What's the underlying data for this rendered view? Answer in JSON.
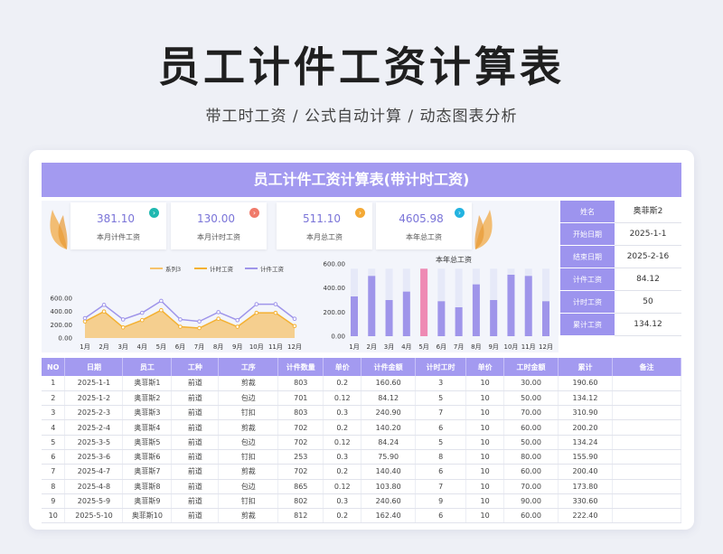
{
  "hero": {
    "title": "员工计件工资计算表",
    "subtitle": "带工时工资 /  公式自动计算  /  动态图表分析"
  },
  "banner": {
    "title": "员工计件工资计算表(带计时工资)"
  },
  "kpis": [
    {
      "value": "381.10",
      "label": "本月计件工资",
      "icon": "chevron-right-icon",
      "color": "#1fb8b0"
    },
    {
      "value": "130.00",
      "label": "本月计时工资",
      "icon": "chevron-right-icon",
      "color": "#f07a6a"
    },
    {
      "value": "511.10",
      "label": "本月总工资",
      "icon": "chevron-right-icon",
      "color": "#f4a935"
    },
    {
      "value": "4605.98",
      "label": "本年总工资",
      "icon": "chevron-right-icon",
      "color": "#23b3e0"
    }
  ],
  "side_info": [
    {
      "key": "姓名",
      "value": "奥菲斯2"
    },
    {
      "key": "开始日期",
      "value": "2025-1-1"
    },
    {
      "key": "结束日期",
      "value": "2025-2-16"
    },
    {
      "key": "计件工资",
      "value": "84.12"
    },
    {
      "key": "计时工资",
      "value": "50"
    },
    {
      "key": "累计工资",
      "value": "134.12"
    }
  ],
  "chart_data": [
    {
      "type": "line",
      "categories": [
        "1月",
        "2月",
        "3月",
        "4月",
        "5月",
        "6月",
        "7月",
        "8月",
        "9月",
        "10月",
        "11月",
        "12月"
      ],
      "series": [
        {
          "name": "系列3",
          "values": [
            250,
            400,
            160,
            270,
            420,
            170,
            150,
            290,
            170,
            380,
            380,
            180
          ],
          "color": "#f6c26b"
        },
        {
          "name": "计时工资",
          "values": [
            250,
            400,
            160,
            270,
            420,
            170,
            150,
            290,
            170,
            380,
            380,
            180
          ],
          "color": "#f4b132"
        },
        {
          "name": "计件工资",
          "values": [
            300,
            500,
            280,
            380,
            560,
            280,
            250,
            390,
            270,
            510,
            510,
            290
          ],
          "color": "#9f95ea"
        }
      ],
      "ylim": [
        0,
        600
      ],
      "yticks": [
        "600.00",
        "400.00",
        "200.00",
        "0.00"
      ],
      "legend": "top"
    },
    {
      "type": "bar",
      "title": "本年总工资",
      "categories": [
        "1月",
        "2月",
        "3月",
        "4月",
        "5月",
        "6月",
        "7月",
        "8月",
        "9月",
        "10月",
        "11月",
        "12月"
      ],
      "values": [
        330,
        500,
        300,
        370,
        560,
        290,
        240,
        430,
        300,
        510,
        500,
        290
      ],
      "background_max": 560,
      "highlight_index": 4,
      "bar_color": "#9f95ea",
      "highlight_color": "#ee8ab4",
      "background_color": "#e6e9f8",
      "ylim": [
        0,
        600
      ],
      "yticks": [
        "600.00",
        "400.00",
        "200.00",
        "0.00"
      ]
    }
  ],
  "table": {
    "headers": [
      "NO",
      "日期",
      "员工",
      "工种",
      "工序",
      "计件数量",
      "单价",
      "计件金额",
      "计时工时",
      "单价",
      "工时金额",
      "累计",
      "备注"
    ],
    "rows": [
      [
        "1",
        "2025-1-1",
        "奥菲斯1",
        "前道",
        "剪裁",
        "803",
        "0.2",
        "160.60",
        "3",
        "10",
        "30.00",
        "190.60",
        ""
      ],
      [
        "2",
        "2025-1-2",
        "奥菲斯2",
        "前道",
        "包边",
        "701",
        "0.12",
        "84.12",
        "5",
        "10",
        "50.00",
        "134.12",
        ""
      ],
      [
        "3",
        "2025-2-3",
        "奥菲斯3",
        "前道",
        "钉扣",
        "803",
        "0.3",
        "240.90",
        "7",
        "10",
        "70.00",
        "310.90",
        ""
      ],
      [
        "4",
        "2025-2-4",
        "奥菲斯4",
        "前道",
        "剪裁",
        "702",
        "0.2",
        "140.20",
        "6",
        "10",
        "60.00",
        "200.20",
        ""
      ],
      [
        "5",
        "2025-3-5",
        "奥菲斯5",
        "前道",
        "包边",
        "702",
        "0.12",
        "84.24",
        "5",
        "10",
        "50.00",
        "134.24",
        ""
      ],
      [
        "6",
        "2025-3-6",
        "奥菲斯6",
        "前道",
        "钉扣",
        "253",
        "0.3",
        "75.90",
        "8",
        "10",
        "80.00",
        "155.90",
        ""
      ],
      [
        "7",
        "2025-4-7",
        "奥菲斯7",
        "前道",
        "剪裁",
        "702",
        "0.2",
        "140.40",
        "6",
        "10",
        "60.00",
        "200.40",
        ""
      ],
      [
        "8",
        "2025-4-8",
        "奥菲斯8",
        "前道",
        "包边",
        "865",
        "0.12",
        "103.80",
        "7",
        "10",
        "70.00",
        "173.80",
        ""
      ],
      [
        "9",
        "2025-5-9",
        "奥菲斯9",
        "前道",
        "钉扣",
        "802",
        "0.3",
        "240.60",
        "9",
        "10",
        "90.00",
        "330.60",
        ""
      ],
      [
        "10",
        "2025-5-10",
        "奥菲斯10",
        "前道",
        "剪裁",
        "812",
        "0.2",
        "162.40",
        "6",
        "10",
        "60.00",
        "222.40",
        ""
      ]
    ]
  }
}
